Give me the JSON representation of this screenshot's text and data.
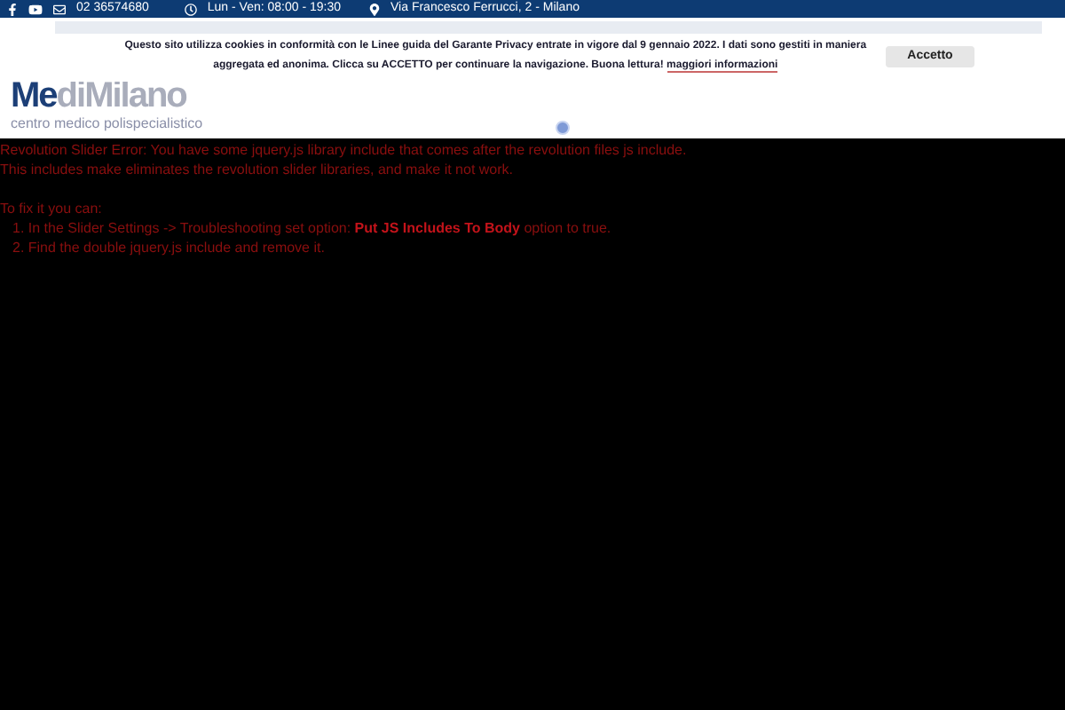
{
  "top_bar": {
    "phone": "02 36574680",
    "hours": "Lun - Ven: 08:00 - 19:30",
    "address": "Via Francesco Ferrucci, 2 - Milano"
  },
  "logo": {
    "part_1": "Me",
    "part_2": "diMilano",
    "tagline": "centro medico polispecialistico"
  },
  "cookie_banner": {
    "message": "Questo sito utilizza cookies in conformità con le Linee guida del Garante Privacy entrate in vigore dal 9 gennaio 2022. I dati sono gestiti in maniera aggregata ed anonima. Clicca su ACCETTO per continuare la navigazione. Buona lettura!",
    "link": "maggiori informazioni",
    "button": "Accetto"
  },
  "error": {
    "lines": [
      "Revolution Slider Error: You have some jquery.js library include that comes after the revolution files js include.",
      "This includes make eliminates the revolution slider libraries, and make it not work."
    ],
    "fix_intro": "To fix it you can:",
    "steps": [
      "1. In the Slider Settings -> Troubleshooting set option: **Put JS Includes To Body** option to true.",
      "2. Find the double jquery.js include and remove it."
    ]
  }
}
